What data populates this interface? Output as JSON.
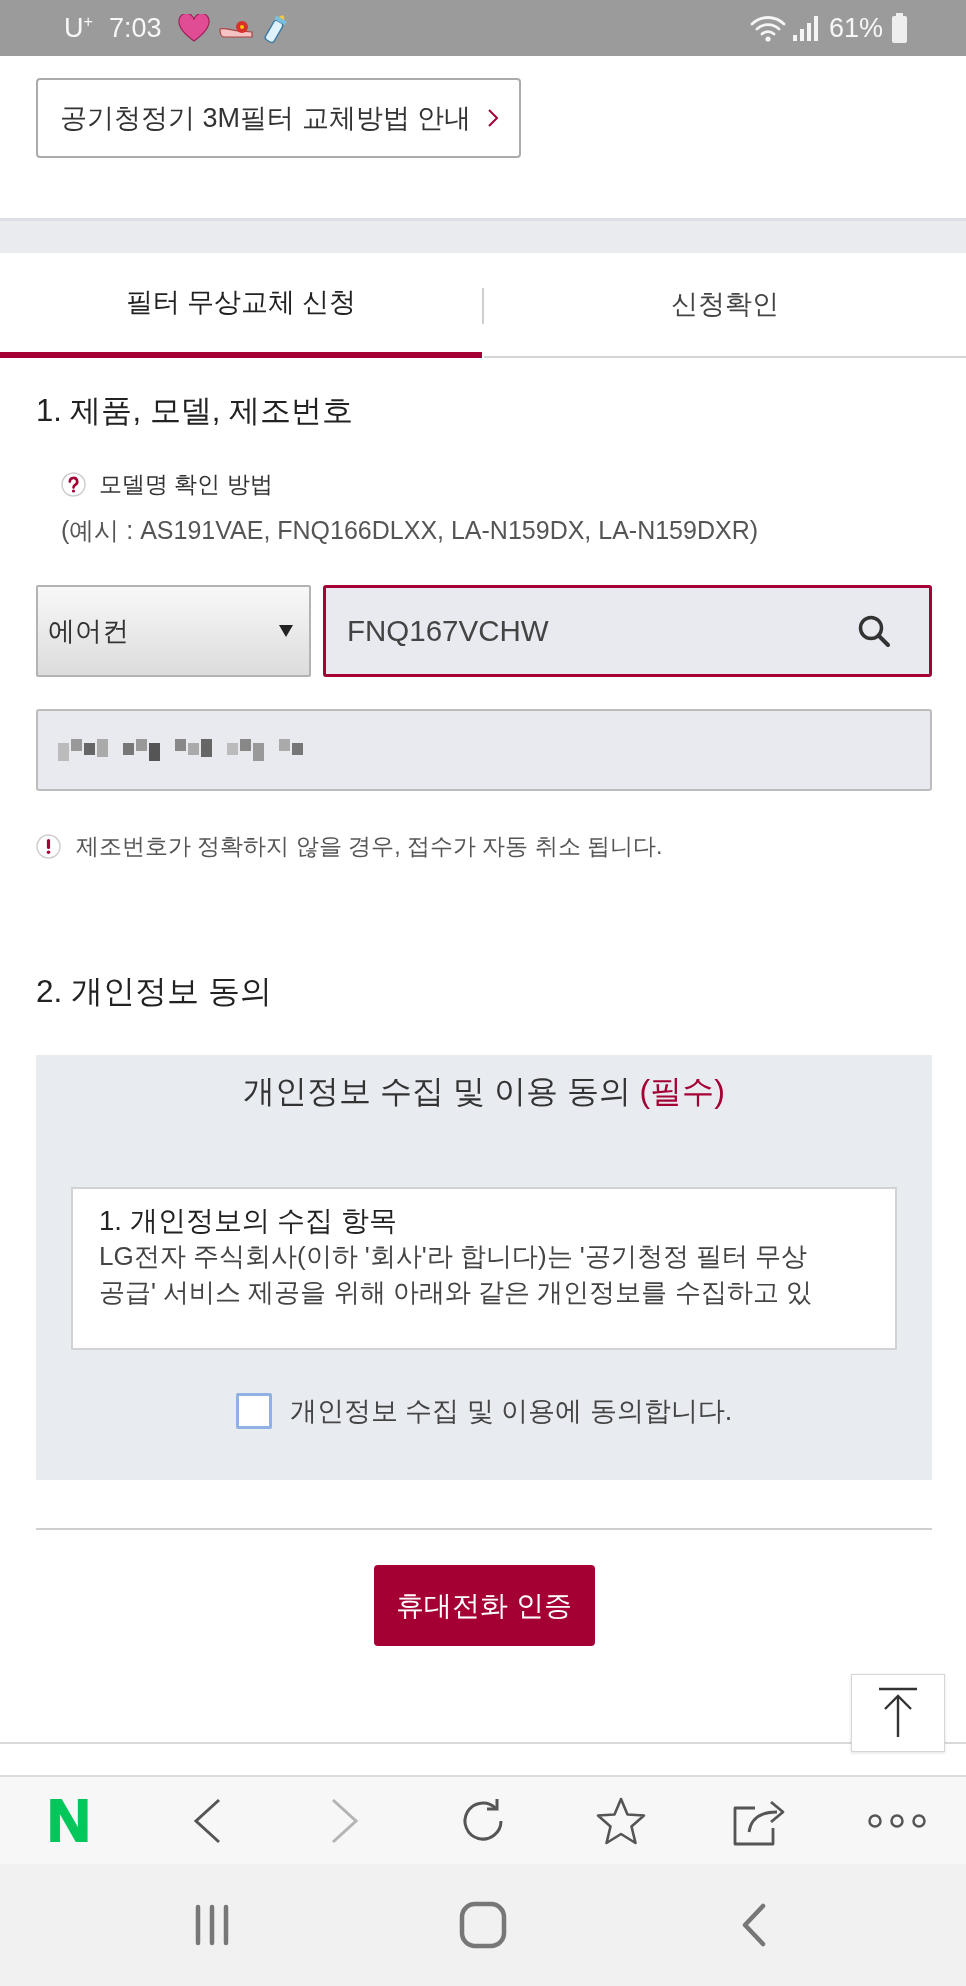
{
  "status_bar": {
    "carrier": "U$^{+}$",
    "time": "7:03",
    "battery": "61%"
  },
  "guide_link": {
    "label": "공기청정기 3M필터 교체방법 안내"
  },
  "tabs": [
    {
      "label": "필터 무상교체 신청",
      "selected": true
    },
    {
      "label": "신청확인",
      "selected": false
    }
  ],
  "section_1": {
    "title": "1. 제품, 모델, 제조번호",
    "help_link": "모델명 확인 방법",
    "example": "(예시 : AS191VAE, FNQ166DLXX, LA-N159DX, LA-N159DXR)",
    "category_select": {
      "value": "에어컨"
    },
    "model_search": {
      "value": "FNQ167VCHW"
    },
    "serial_field": {
      "blurred": true
    },
    "warning": "제조번호가 정확하지 않을 경우, 접수가 자동 취소 됩니다."
  },
  "section_2": {
    "title": "2. 개인정보 동의",
    "consent_panel": {
      "title": "개인정보 수집 및 이용 동의",
      "required_tag": "(필수)",
      "terms": {
        "heading": "1. 개인정보의 수집 항목",
        "body": "LG전자 주식회사(이하 '회사'라 합니다)는 '공기청정 필터 무상 공급' 서비스 제공을 위해 아래와 같은 개인정보를 수집하고 있"
      },
      "agree_checkbox": {
        "label": "개인정보 수집 및 이용에 동의합니다.",
        "checked": false
      }
    },
    "verify_button": "휴대전화 인증"
  },
  "browser_toolbar": {
    "logo": "N",
    "buttons": [
      {
        "kind": "back",
        "disabled": false
      },
      {
        "kind": "forward",
        "disabled": true
      },
      {
        "kind": "reload",
        "disabled": false
      },
      {
        "kind": "bookmark",
        "disabled": false
      },
      {
        "kind": "share",
        "disabled": false
      },
      {
        "kind": "more",
        "disabled": false
      }
    ]
  },
  "nav_bar": {
    "buttons": [
      {
        "kind": "recents"
      },
      {
        "kind": "home"
      },
      {
        "kind": "back"
      }
    ]
  }
}
